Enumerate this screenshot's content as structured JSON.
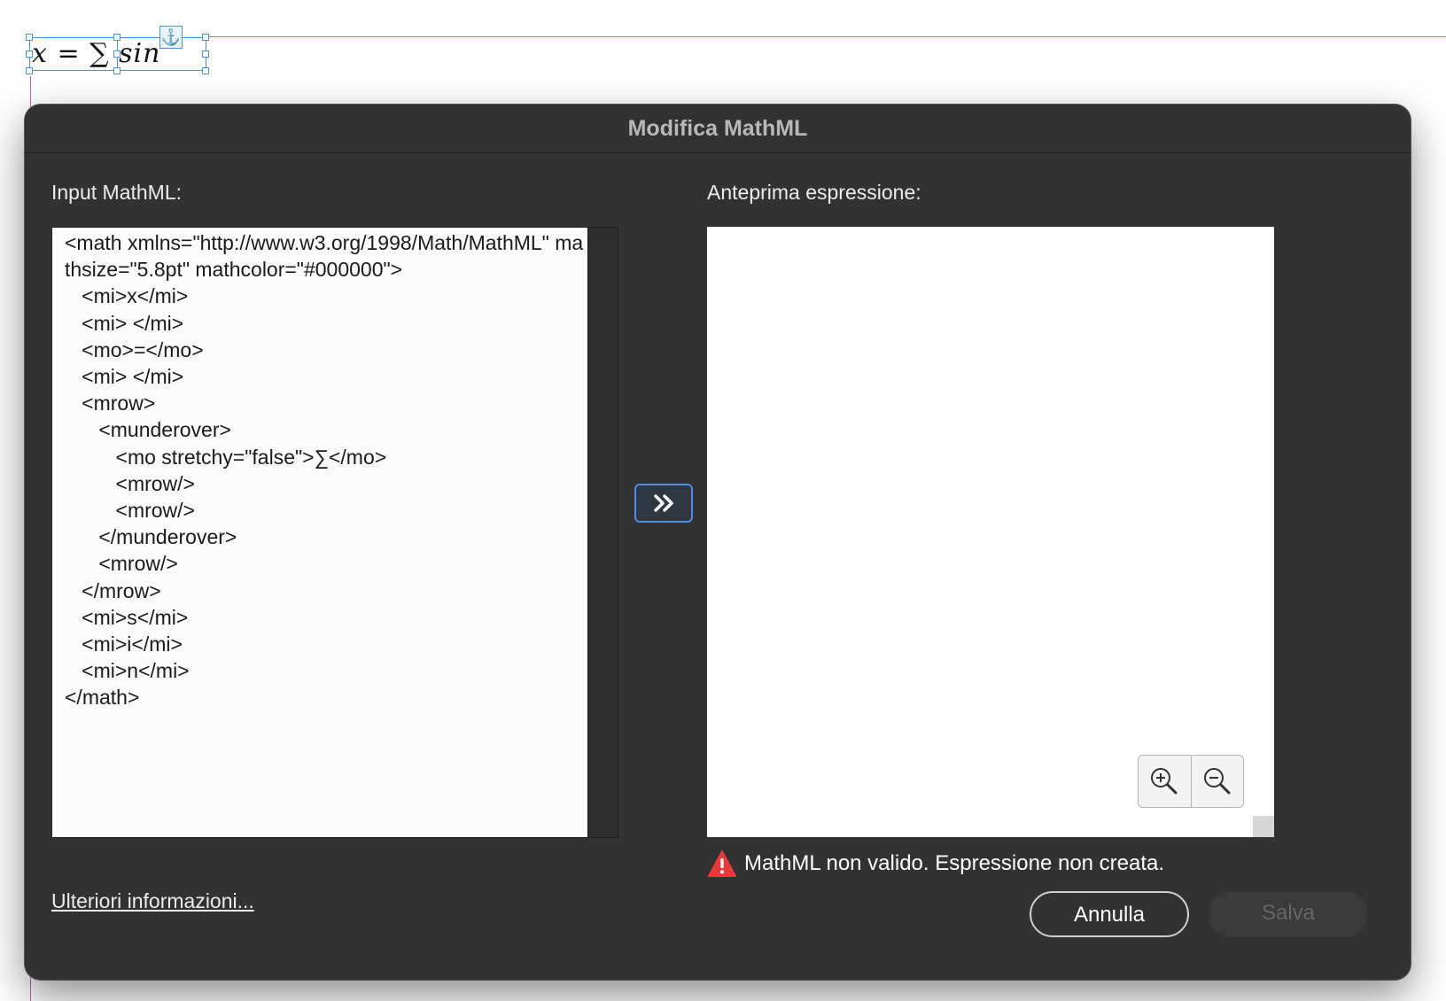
{
  "canvas": {
    "formula_text": "x = ∑ sin",
    "anchor_icon": "anchor-icon",
    "guide_color": "#c85ac8",
    "selection_color": "#4a90d9"
  },
  "dialog": {
    "title": "Modifica MathML",
    "input_label": "Input MathML:",
    "preview_label": "Anteprima espressione:",
    "mathml_input": "<math xmlns=\"http://www.w3.org/1998/Math/MathML\" mathsize=\"5.8pt\" mathcolor=\"#000000\">\n   <mi>x</mi>\n   <mi> </mi>\n   <mo>=</mo>\n   <mi> </mi>\n   <mrow>\n      <munderover>\n         <mo stretchy=\"false\">∑</mo>\n         <mrow/>\n         <mrow/>\n      </munderover>\n      <mrow/>\n   </mrow>\n   <mi>s</mi>\n   <mi>i</mi>\n   <mi>n</mi>\n</math>",
    "convert_button_glyph": "»",
    "zoom_in_icon": "zoom-in-icon",
    "zoom_out_icon": "zoom-out-icon",
    "status": {
      "icon": "warning-icon",
      "text": "MathML non valido. Espressione non creata.",
      "icon_color": "#e83a3a"
    },
    "more_info_link": "Ulteriori informazioni...",
    "cancel_label": "Annulla",
    "save_label": "Salva",
    "accent_color": "#4a8fe0"
  }
}
